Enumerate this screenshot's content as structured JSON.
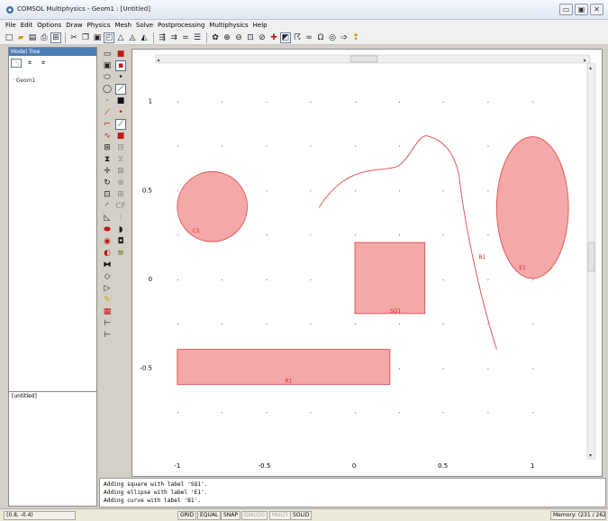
{
  "window": {
    "title": "COMSOL Multiphysics - Geom1 : [Untitled]",
    "controls": {
      "minimize": "▭",
      "maximize": "▣",
      "close": "✕"
    }
  },
  "menu": [
    "File",
    "Edit",
    "Options",
    "Draw",
    "Physics",
    "Mesh",
    "Solve",
    "Postprocessing",
    "Multiphysics",
    "Help"
  ],
  "model_tree": {
    "header": "Model Tree",
    "toolbar": [
      "⋱",
      "±",
      "±"
    ],
    "item": "Geom1"
  },
  "untitled_panel": {
    "label": "[untitled]"
  },
  "canvas": {
    "x_ticks": [
      "-1",
      "-0.5",
      "0",
      "0.5",
      "1"
    ],
    "y_ticks": [
      "1",
      "0.5",
      "0",
      "-0.5"
    ],
    "objects": {
      "c1": "C1",
      "e1": "E1",
      "b1": "B1",
      "sq1": "SQ1",
      "r1": "R1"
    },
    "colors": {
      "fill": "#f5a8a8",
      "stroke": "#e05a5a",
      "label": "#d03030"
    }
  },
  "log": {
    "lines": [
      "Adding square with label 'SQ1'.",
      "Adding ellipse with label 'E1'.",
      "Adding curve with label 'B1'."
    ]
  },
  "status": {
    "coords": "(0.8, -0.4)",
    "grid": "GRID",
    "equal": "EQUAL",
    "snap": "SNAP",
    "dialog": "DIALOG",
    "multi": "MULTI",
    "solid": "SOLID",
    "memory": "Memory: (231 / 262"
  }
}
